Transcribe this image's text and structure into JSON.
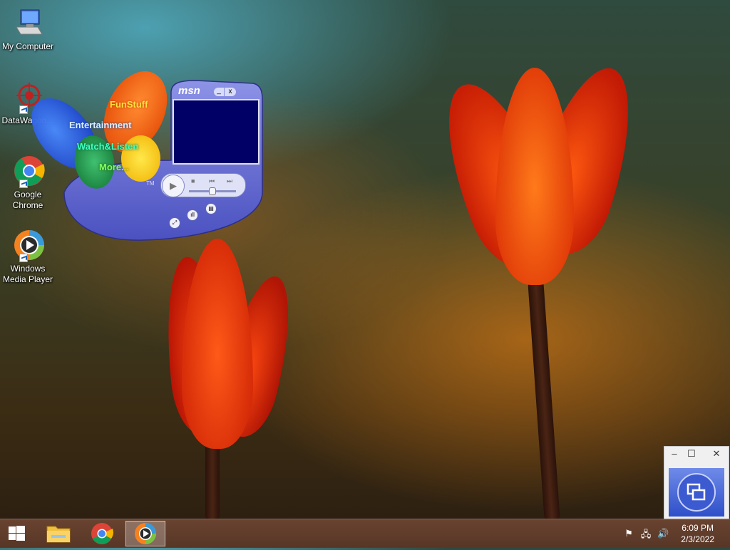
{
  "desktop": {
    "icons": [
      {
        "label": "My Computer",
        "icon": "computer-icon"
      },
      {
        "label": "DataWagon...",
        "icon": "datawagon-icon"
      },
      {
        "label": "Google Chrome",
        "icon": "chrome-icon"
      },
      {
        "label": "Windows Media Player",
        "icon": "media-player-icon"
      }
    ]
  },
  "msn_player": {
    "brand": "msn",
    "trademark": "TM",
    "menu": [
      "FunStuff",
      "Entertainment",
      "Watch&Listen",
      "More..."
    ],
    "colors": {
      "body": "#6a6fd0",
      "screen": "#000066",
      "orange": "#ff6a00",
      "blue": "#2060ff",
      "green": "#20a040",
      "yellow": "#ffd000"
    }
  },
  "taskbar": {
    "time": "6:09 PM",
    "date": "2/3/2022",
    "buttons": [
      "start-button",
      "file-explorer-button",
      "chrome-button",
      "media-player-button"
    ]
  },
  "mini_window": {
    "minimize": "–",
    "maximize": "☐",
    "close": "✕"
  }
}
